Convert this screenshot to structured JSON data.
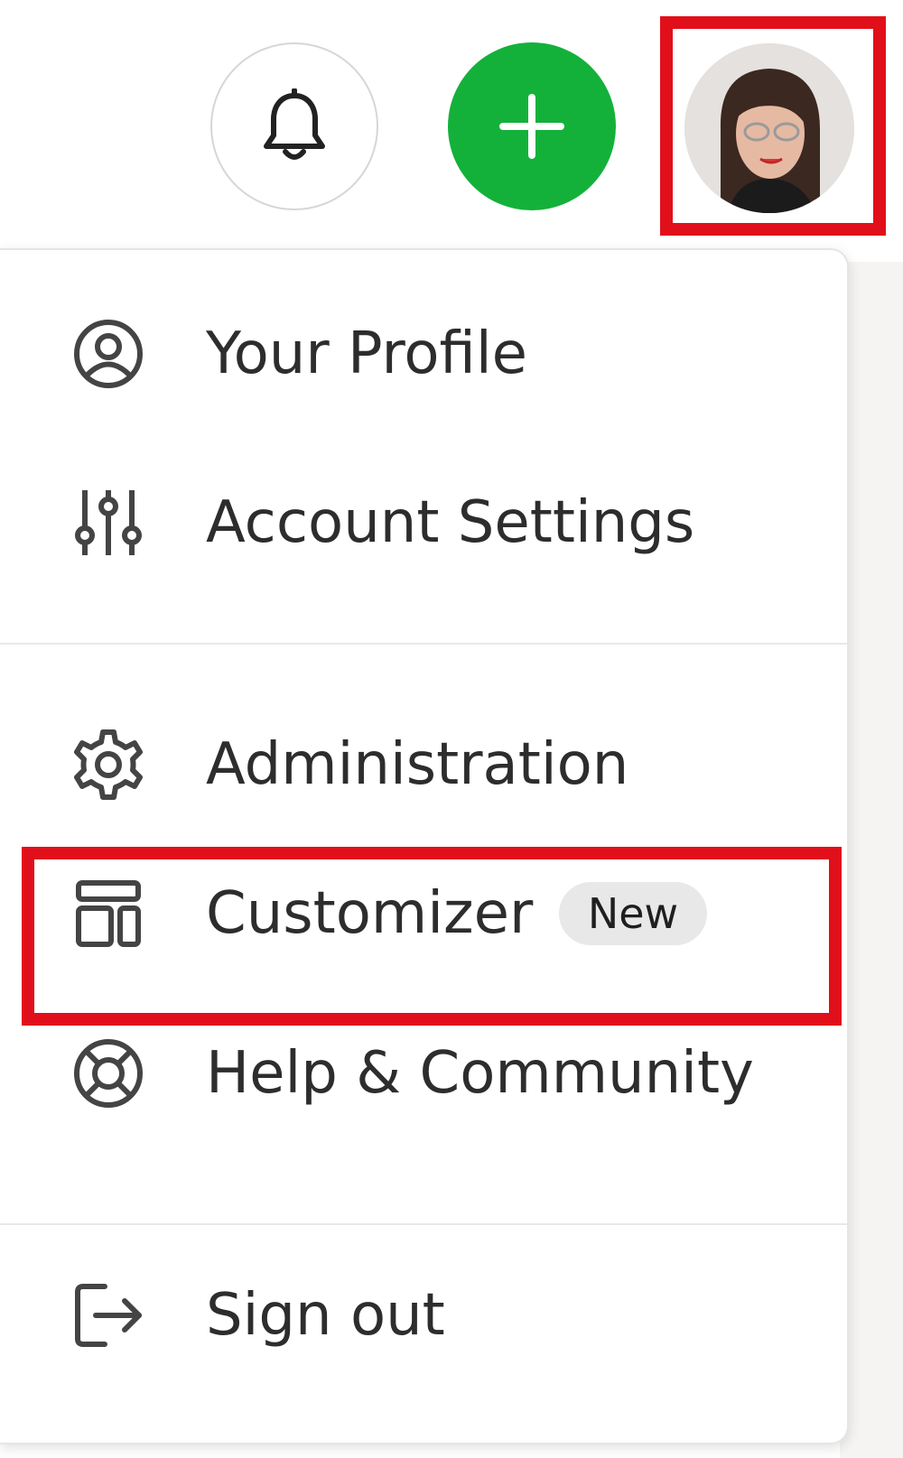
{
  "header": {
    "notifications_icon": "bell-icon",
    "create_icon": "plus-icon",
    "avatar_icon": "user-avatar"
  },
  "menu": {
    "items": [
      {
        "label": "Your Profile",
        "icon": "user-circle-icon"
      },
      {
        "label": "Account Settings",
        "icon": "sliders-icon"
      },
      {
        "label": "Administration",
        "icon": "gear-icon"
      },
      {
        "label": "Customizer",
        "icon": "layout-icon",
        "badge": "New"
      },
      {
        "label": "Help & Community",
        "icon": "lifebuoy-icon"
      },
      {
        "label": "Sign out",
        "icon": "sign-out-icon"
      }
    ]
  },
  "colors": {
    "accent_green": "#13b13a",
    "highlight_red": "#e10f1a",
    "badge_bg": "#e8e8e8"
  }
}
